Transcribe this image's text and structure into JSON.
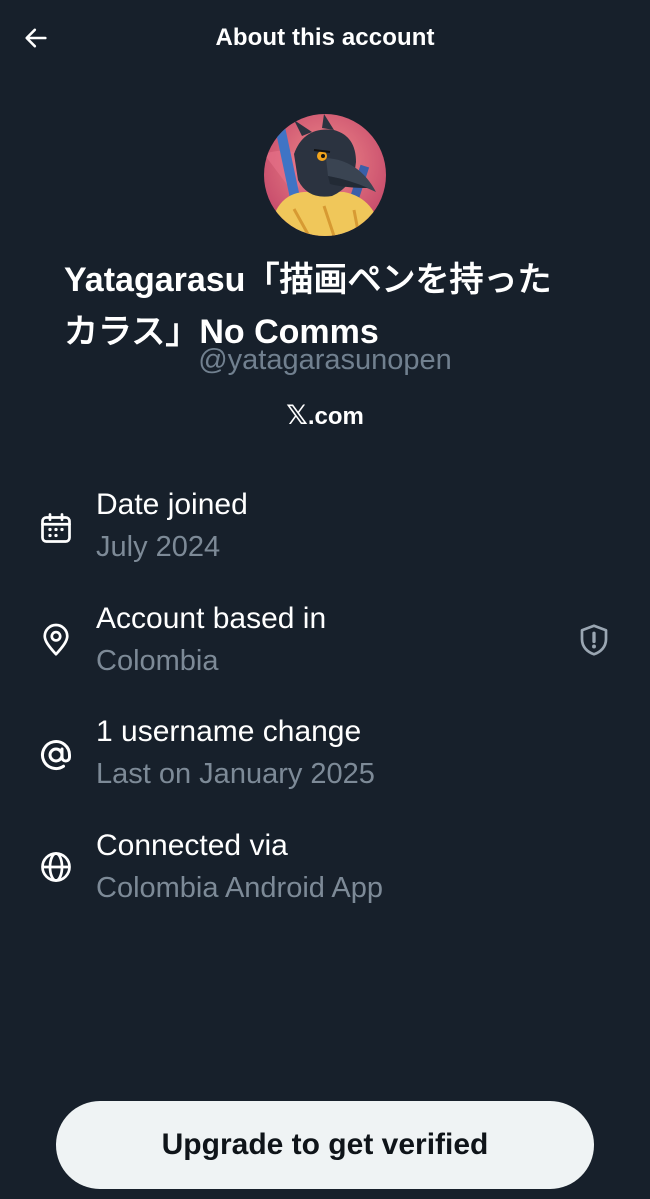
{
  "header": {
    "title": "About this account",
    "back_icon": "arrow-left-icon"
  },
  "profile": {
    "avatar_alt": "crow illustration avatar",
    "display_name": "Yatagarasu「描画ペンを持った\nカラス」No Comms",
    "handle": "@yatagarasunopen",
    "site_glyph": "𝕏",
    "site_suffix": ".com"
  },
  "details": [
    {
      "icon": "calendar-icon",
      "title": "Date joined",
      "subtitle": "July 2024"
    },
    {
      "icon": "location-pin-icon",
      "title": "Account based in",
      "subtitle": "Colombia",
      "trailing_icon": "shield-alert-icon"
    },
    {
      "icon": "at-sign-icon",
      "title": "1 username change",
      "subtitle": "Last on January 2025"
    },
    {
      "icon": "globe-icon",
      "title": "Connected via",
      "subtitle": "Colombia Android App"
    }
  ],
  "cta": {
    "label": "Upgrade to get verified"
  },
  "colors": {
    "background": "#17202b",
    "text_primary": "#ffffff",
    "text_secondary": "#7d8a97",
    "button_bg": "#eff3f4",
    "button_text": "#0f1419"
  }
}
